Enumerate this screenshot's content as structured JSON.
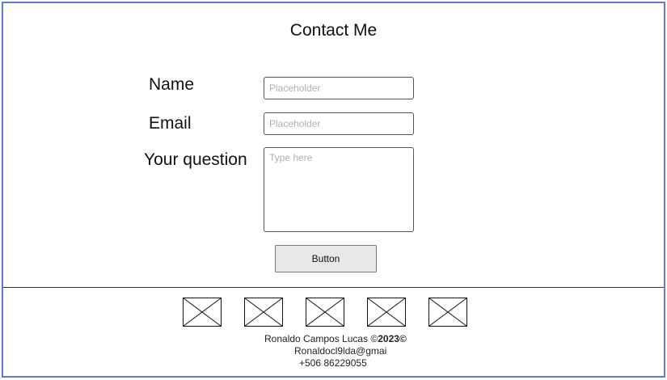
{
  "page": {
    "title": "Contact Me"
  },
  "form": {
    "name_label": "Name",
    "name_placeholder": "Placeholder",
    "email_label": "Email",
    "email_placeholder": "Placeholder",
    "question_label": "Your question",
    "question_placeholder": "Type here",
    "submit_label": "Button"
  },
  "footer": {
    "social_icons": [
      "image-placeholder-icon",
      "image-placeholder-icon",
      "image-placeholder-icon",
      "image-placeholder-icon",
      "image-placeholder-icon"
    ],
    "copyright_name": "Ronaldo Campos Lucas ©",
    "copyright_year": "2023©",
    "email": "Ronaldocl9lda@gmai",
    "phone": "+506 86229055"
  },
  "colors": {
    "frame_border": "#5a7bd8",
    "button_bg": "#e8e8e8"
  }
}
